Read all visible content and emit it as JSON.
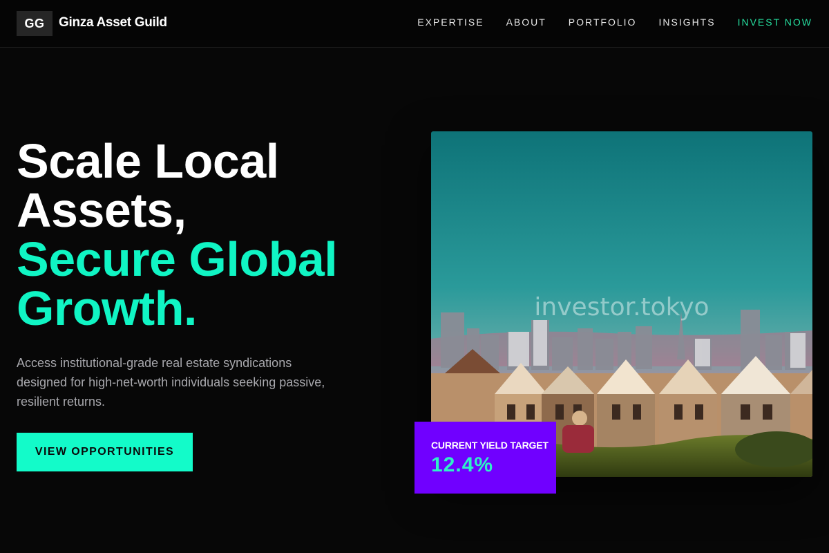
{
  "brand": {
    "badge": "GG",
    "name": "Ginza Asset Guild"
  },
  "nav": {
    "items": [
      {
        "label": "EXPERTISE"
      },
      {
        "label": "ABOUT"
      },
      {
        "label": "PORTFOLIO"
      },
      {
        "label": "INSIGHTS"
      }
    ],
    "cta": "INVEST NOW"
  },
  "hero": {
    "title_lines": [
      "Scale Local",
      "Assets,"
    ],
    "accent_lines": [
      "Secure Global",
      "Growth."
    ],
    "description": "Access institutional-grade real estate syndications designed for high-net-worth individuals seeking passive, resilient returns.",
    "button_label": "VIEW OPPORTUNITIES"
  },
  "image": {
    "watermark": "investor.tokyo"
  },
  "yield_card": {
    "label": "CURRENT YIELD TARGET",
    "value": "12.4%"
  },
  "colors": {
    "accent": "#10f5c4",
    "cta_nav": "#26e0a0",
    "card": "#7000ff",
    "background": "#070707"
  }
}
